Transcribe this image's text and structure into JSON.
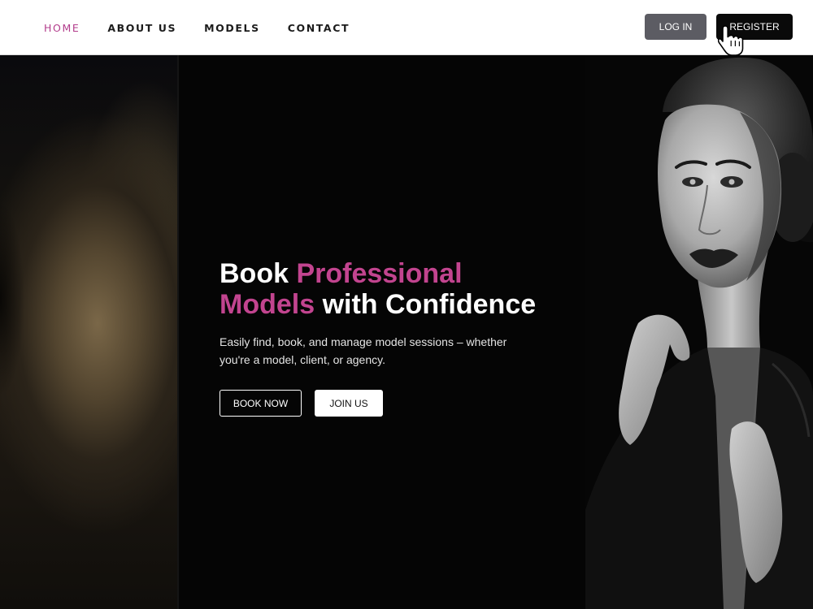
{
  "nav": {
    "items": [
      {
        "label": "HOME",
        "active": true
      },
      {
        "label": "ABOUT US",
        "active": false
      },
      {
        "label": "MODELS",
        "active": false
      },
      {
        "label": "CONTACT",
        "active": false
      }
    ]
  },
  "auth": {
    "login_label": "LOG IN",
    "register_label": "REGISTER"
  },
  "hero": {
    "headline_word1": "Book",
    "headline_word2": "Professional",
    "headline_word3": "Models",
    "headline_word4": "with Confidence",
    "subtitle_line1": "Easily find, book, and manage model sessions – whether",
    "subtitle_line2": "you're a model, client, or agency.",
    "book_label": "BOOK NOW",
    "join_label": "JOIN US"
  },
  "colors": {
    "accent": "#c2448f",
    "nav_active": "#b33d8c",
    "login_bg": "#5c5c63",
    "register_bg": "#0a0a0a",
    "hero_bg": "#050505"
  },
  "icons": {
    "cursor": "hand-pointer-icon"
  }
}
